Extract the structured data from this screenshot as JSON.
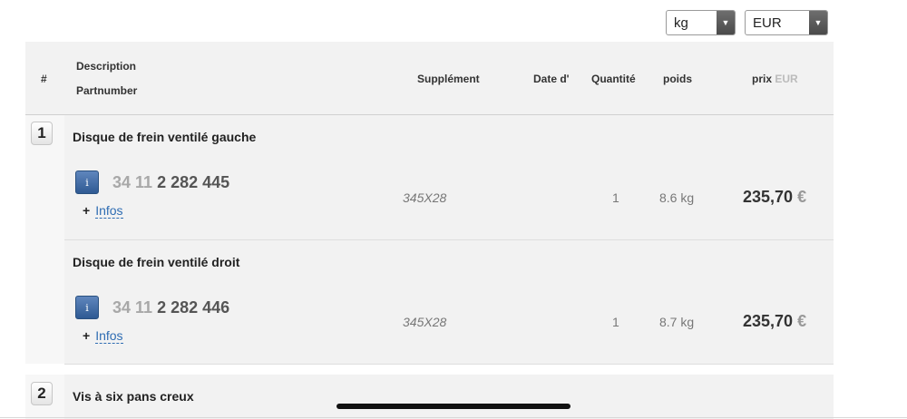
{
  "controls": {
    "unit_select": {
      "value": "kg"
    },
    "currency_select": {
      "value": "EUR"
    }
  },
  "table_header": {
    "index": "#",
    "description": "Description",
    "partnumber": "Partnumber",
    "supplement": "Supplément",
    "date": "Date d'",
    "quantity": "Quantité",
    "weight": "poids",
    "price": "prix",
    "price_currency": "EUR"
  },
  "groups": [
    {
      "number": "1",
      "items": [
        {
          "title": "Disque de frein ventilé gauche",
          "info_button": "i",
          "part_prefix": "34 11",
          "part_main": "2 282 445",
          "infos_plus": "+",
          "infos_label": "Infos",
          "supplement": "345X28",
          "quantity": "1",
          "weight": "8.6 kg",
          "price": "235,70",
          "currency_symbol": "€"
        },
        {
          "title": "Disque de frein ventilé droit",
          "info_button": "i",
          "part_prefix": "34 11",
          "part_main": "2 282 446",
          "infos_plus": "+",
          "infos_label": "Infos",
          "supplement": "345X28",
          "quantity": "1",
          "weight": "8.7 kg",
          "price": "235,70",
          "currency_symbol": "€"
        }
      ]
    },
    {
      "number": "2",
      "items": [
        {
          "title": "Vis à six pans creux"
        }
      ]
    }
  ]
}
